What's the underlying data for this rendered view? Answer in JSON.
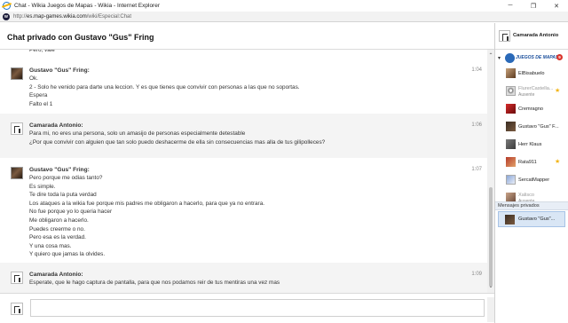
{
  "window": {
    "title": "Chat - Wikia Juegos de Mapas - Wikia - Internet Explorer",
    "controls": {
      "minimize": "─",
      "restore": "❐",
      "close": "✕"
    }
  },
  "address": {
    "prefix": "http://",
    "host": "es.map-games.wikia.com",
    "path": "/wiki/Especial:Chat",
    "site_icon_letter": "w"
  },
  "chat": {
    "title": "Chat privado con Gustavo \"Gus\" Fring",
    "partial_line": "Pero, vale",
    "messages": [
      {
        "author": "Gustavo \"Gus\" Fring:",
        "time": "1:04",
        "avatar": "fring",
        "alt": false,
        "lines": [
          "Ok.",
          "2 - Solo he venido para darte una leccion. Y es que tienes que convivir con personas a las que no soportas.",
          "Espera",
          "Falto el 1"
        ]
      },
      {
        "author": "Camarada Antonio:",
        "time": "1:06",
        "avatar": "antonio",
        "alt": true,
        "lines": [
          "Para mi, no eres una persona, solo un amasijo de personas especialmente detestable",
          "¿Por que convivir con alguien que tan solo puedo deshacerme de ella sin consecuencias mas alla de tus gilipolleces?"
        ]
      },
      {
        "author": "Gustavo \"Gus\" Fring:",
        "time": "1:07",
        "avatar": "fring",
        "alt": false,
        "lines": [
          "Pero porque me odias tanto?",
          "Es simple.",
          "Te dire toda la puta verdad",
          "Los ataques a la wikia fue porque mis padres me obligaron a hacerlo, para que ya no entrara.",
          "No fue porque yo lo queria hacer",
          "Me obligaron a hacerlo.",
          "Puedes creerme o no.",
          "Pero esa es la verdad.",
          "Y una cosa mas.",
          "Y quiero que jamas la olvides."
        ]
      },
      {
        "author": "Camarada Antonio:",
        "time": "1:09",
        "avatar": "antonio",
        "alt": true,
        "lines": [
          "Esperate, que le hago captura de pantalla, para que nos podamos reir de tus mentiras una vez mas"
        ]
      }
    ],
    "composer_value": ""
  },
  "scrollbar": {
    "up": "⌃",
    "down": "⌄"
  },
  "sidebar": {
    "me": {
      "name": "Camarada Antonio"
    },
    "room": {
      "chevron": "▾",
      "logo_text": "JUEGOS DE MAPAS",
      "badge": "9"
    },
    "users": [
      {
        "name": "ElBisabuelo",
        "status": "",
        "avatar": "c1",
        "star": false,
        "away": false
      },
      {
        "name": "FlurerCastella...",
        "status": "Ausente",
        "avatar": "c2",
        "star": true,
        "away": true
      },
      {
        "name": "Cremragno",
        "status": "",
        "avatar": "c3",
        "star": false,
        "away": false
      },
      {
        "name": "Gustavo \"Gus\" F...",
        "status": "",
        "avatar": "c4",
        "star": false,
        "away": false
      },
      {
        "name": "Herr Klaus",
        "status": "",
        "avatar": "c5",
        "star": false,
        "away": false
      },
      {
        "name": "Rata911",
        "status": "",
        "avatar": "c6",
        "star": true,
        "away": false
      },
      {
        "name": "SercatMapper",
        "status": "",
        "avatar": "c7",
        "star": false,
        "away": false
      },
      {
        "name": "Xalisco",
        "status": "Ausente",
        "avatar": "c8",
        "star": false,
        "away": true
      }
    ],
    "star_glyph": "★",
    "private_header": "Mensajes privados",
    "private_item": {
      "name": "Gustavo \"Gus\"..."
    }
  }
}
